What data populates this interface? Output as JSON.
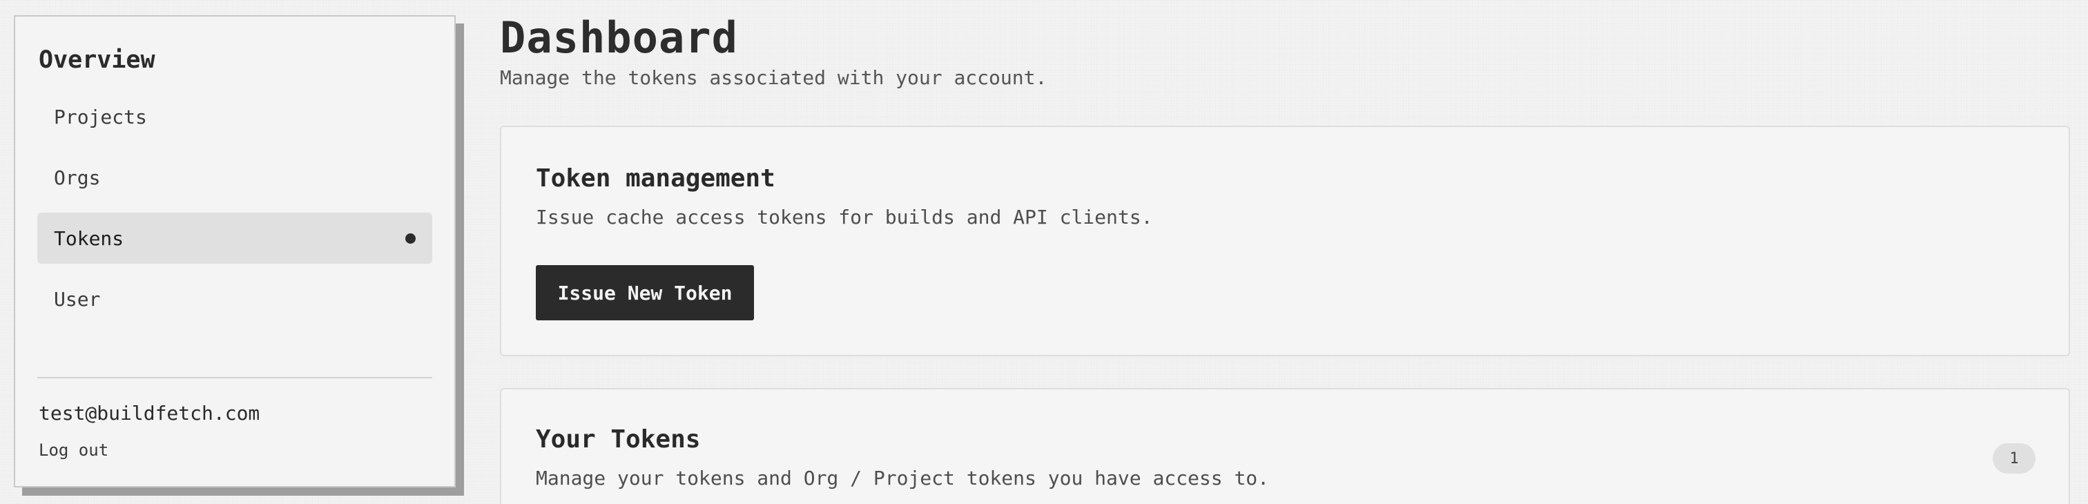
{
  "sidebar": {
    "title": "Overview",
    "items": [
      {
        "label": "Projects",
        "active": false
      },
      {
        "label": "Orgs",
        "active": false
      },
      {
        "label": "Tokens",
        "active": true
      },
      {
        "label": "User",
        "active": false
      }
    ],
    "user_email": "test@buildfetch.com",
    "logout_label": "Log out"
  },
  "main": {
    "title": "Dashboard",
    "subtitle": "Manage the tokens associated with your account.",
    "token_management": {
      "title": "Token management",
      "description": "Issue cache access tokens for builds and API clients.",
      "button_label": "Issue New Token"
    },
    "your_tokens": {
      "title": "Your Tokens",
      "description": "Manage your tokens and Org / Project tokens you have access to.",
      "count": "1"
    }
  },
  "colors": {
    "background": "#f2f2f2",
    "primary_button": "#2b2b2b",
    "active_nav": "#e0e0e0",
    "sidebar_shadow": "#9e9e9e"
  }
}
